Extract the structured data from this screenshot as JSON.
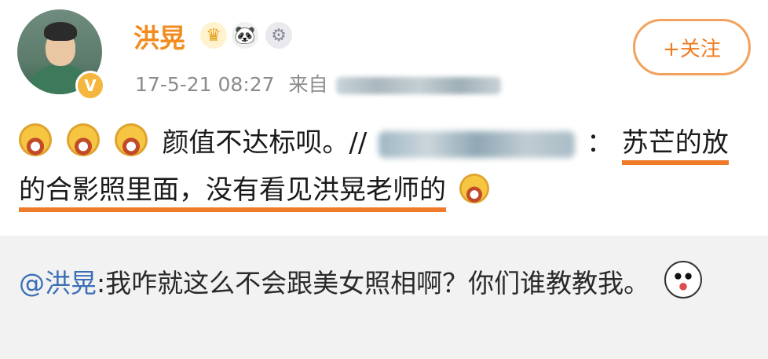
{
  "post": {
    "author": "洪晃",
    "verified_icon": "v-badge-icon",
    "badges": [
      "crown-icon",
      "panda-icon",
      "medal-icon"
    ],
    "timestamp": "17-5-21 08:27",
    "source_prefix": "来自",
    "follow_label": "+关注"
  },
  "content": {
    "line1": "颜值不达标呗。//",
    "after_blur": "：",
    "highlight1": "苏芒的放",
    "highlight2": "的合影照里面，没有看见洪晃老师的"
  },
  "quote": {
    "mention": "@洪晃",
    "text": ":我咋就这么不会跟美女照相啊？你们谁教教我。"
  }
}
